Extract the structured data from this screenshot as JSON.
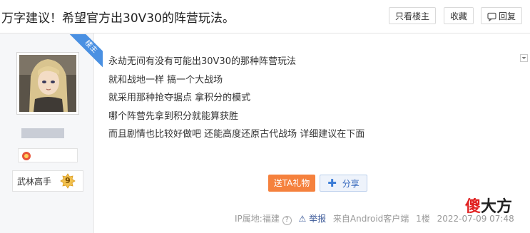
{
  "header": {
    "title": "万字建议！希望官方出30V30的阵营玩法。",
    "only_host_label": "只看楼主",
    "favorite_label": "收藏",
    "reply_label": "回复"
  },
  "author": {
    "host_badge": "楼主",
    "level_name": "武林高手",
    "level_number": "9"
  },
  "post": {
    "lines": [
      "永劫无间有没有可能出30V30的那种阵营玩法",
      "就和战地一样 搞一个大战场",
      "就采用那种抢夺据点 拿积分的模式",
      "哪个阵营先拿到积分就能算获胜",
      "而且剧情也比较好做吧 还能高度还原古代战场 详细建议在下面"
    ]
  },
  "actions": {
    "gift_label": "送TA礼物",
    "share_label": "分享"
  },
  "footer": {
    "ip_location": "IP属地:福建",
    "report_label": "举报",
    "source": "来自Android客户端",
    "floor": "1楼",
    "timestamp": "2022-07-09 07:48"
  },
  "watermark": {
    "part1": "傻",
    "part2": "大方"
  },
  "colors": {
    "gift": "#f5813d",
    "share": "#3366bb",
    "host_ribbon": "#4a90e2",
    "watermark_red": "#e02020"
  }
}
